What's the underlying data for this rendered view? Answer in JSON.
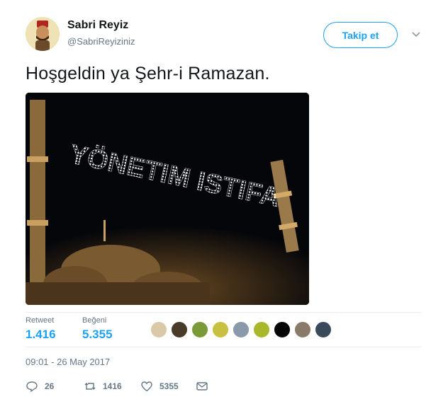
{
  "user": {
    "name": "Sabri Reyiz",
    "handle": "@SabriReyiziniz"
  },
  "follow_label": "Takip et",
  "tweet": {
    "text": "Hoşgeldin ya Şehr-i Ramazan.",
    "image_banner": "YÖNETIM ISTIFA"
  },
  "stats": {
    "retweet_label": "Retweet",
    "retweet_count": "1.416",
    "like_label": "Beğeni",
    "like_count": "5.355"
  },
  "timestamp": "09:01 - 26 May 2017",
  "actions": {
    "reply_count": "26",
    "retweet_count": "1416",
    "like_count": "5355"
  },
  "colors": {
    "accent": "#1da1f2",
    "muted": "#657786"
  }
}
